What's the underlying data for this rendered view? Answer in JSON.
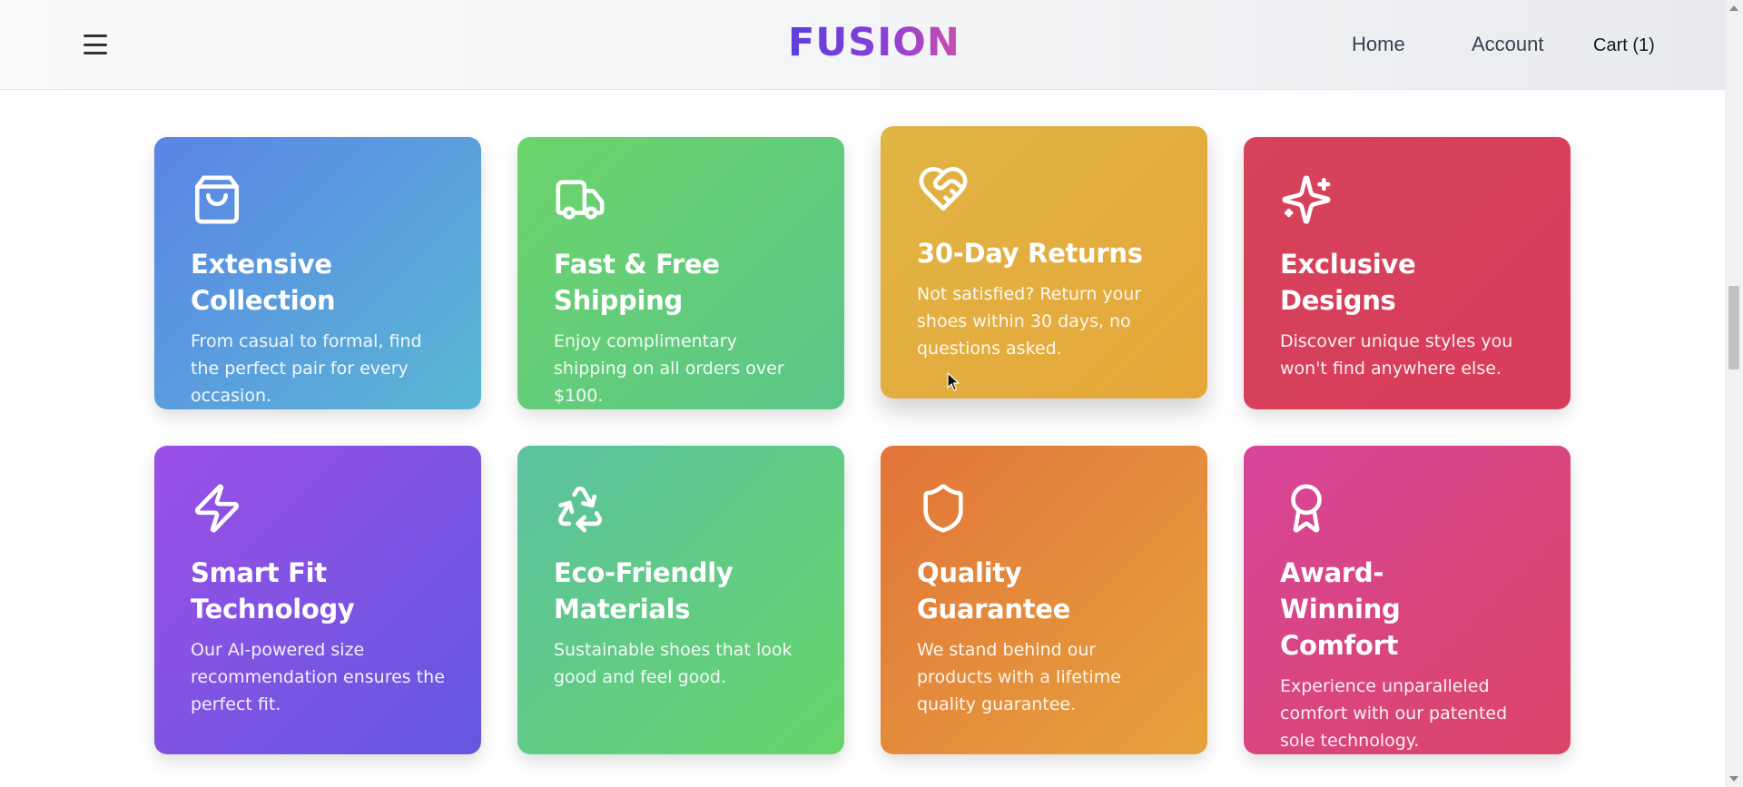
{
  "header": {
    "logo": "FUSION",
    "nav": {
      "home": "Home",
      "account": "Account",
      "cart": "Cart (1)"
    }
  },
  "features": [
    {
      "icon": "shopping-bag-icon",
      "title": "Extensive Collection",
      "description": "From casual to formal, find the perfect pair for every occasion."
    },
    {
      "icon": "truck-icon",
      "title": "Fast & Free Shipping",
      "description": "Enjoy complimentary shipping on all orders over $100."
    },
    {
      "icon": "heart-handshake-icon",
      "title": "30-Day Returns",
      "description": "Not satisfied? Return your shoes within 30 days, no questions asked."
    },
    {
      "icon": "sparkles-icon",
      "title": "Exclusive Designs",
      "description": "Discover unique styles you won't find anywhere else."
    },
    {
      "icon": "zap-icon",
      "title": "Smart Fit Technology",
      "description": "Our AI-powered size recommendation ensures the perfect fit."
    },
    {
      "icon": "recycle-icon",
      "title": "Eco-Friendly Materials",
      "description": "Sustainable shoes that look good and feel good."
    },
    {
      "icon": "shield-icon",
      "title": "Quality Guarantee",
      "description": "We stand behind our products with a lifetime quality guarantee."
    },
    {
      "icon": "award-icon",
      "title": "Award-Winning Comfort",
      "description": "Experience unparalleled comfort with our patented sole technology."
    }
  ],
  "colors": {
    "logo_gradient": [
      "#5b3fd9",
      "#c94fb0"
    ],
    "card_gradients": [
      [
        "#5a84e6",
        "#5ab8d4"
      ],
      [
        "#6bd46a",
        "#5cc58a"
      ],
      [
        "#e0b544",
        "#e6a63a"
      ],
      [
        "#d6435a",
        "#d83c5c"
      ],
      [
        "#9b4fe6",
        "#6358e0"
      ],
      [
        "#5cc2a0",
        "#67d46a"
      ],
      [
        "#e2743a",
        "#e6a33c"
      ],
      [
        "#d7459a",
        "#dc4566"
      ]
    ]
  }
}
